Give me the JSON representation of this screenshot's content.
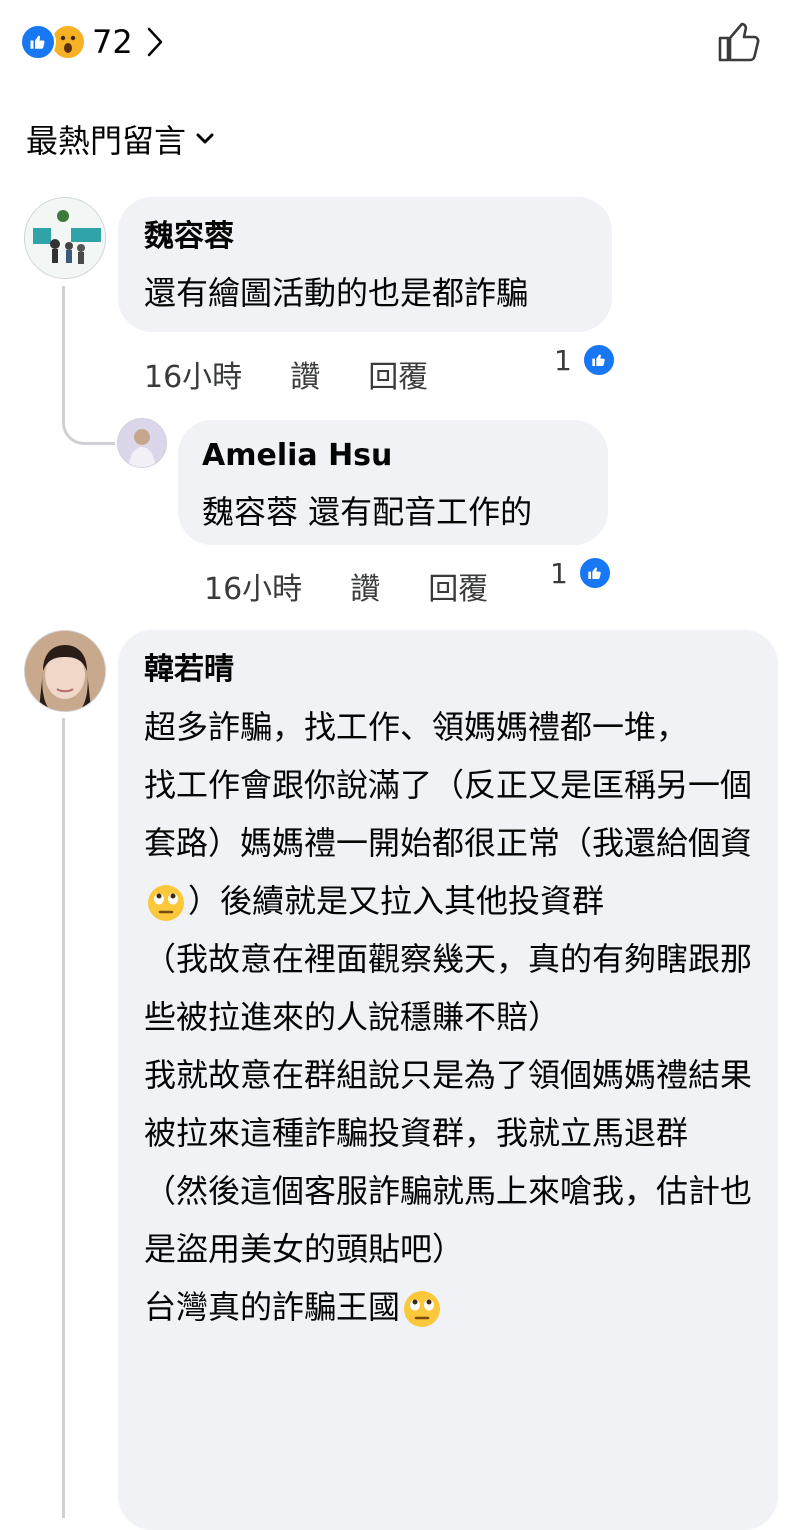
{
  "reactions": {
    "count": "72"
  },
  "sort": {
    "label": "最熱門留言"
  },
  "comments": [
    {
      "name": "魏容蓉",
      "text": "還有繪圖活動的也是都詐騙",
      "time": "16小時",
      "like_label": "讚",
      "reply_label": "回覆",
      "reaction_count": "1",
      "replies": [
        {
          "name": "Amelia Hsu",
          "text": "魏容蓉 還有配音工作的",
          "time": "16小時",
          "like_label": "讚",
          "reply_label": "回覆",
          "reaction_count": "1"
        }
      ]
    },
    {
      "name": "韓若晴",
      "paragraphs": [
        "超多詐騙，找工作、領媽媽禮都一堆，",
        "找工作會跟你說滿了（反正又是匡稱另一個套路）媽媽禮一開始都很正常（我還給個資",
        "）後續就是又拉入其他投資群",
        "（我故意在裡面觀察幾天，真的有夠瞎跟那些被拉進來的人說穩賺不賠）",
        "我就故意在群組說只是為了領個媽媽禮結果被拉來這種詐騙投資群，我就立馬退群",
        "（然後這個客服詐騙就馬上來嗆我，估計也是盜用美女的頭貼吧）",
        "台灣真的詐騙王國"
      ],
      "emojis": [
        "face-with-rolling-eyes",
        "face-with-rolling-eyes"
      ]
    }
  ]
}
